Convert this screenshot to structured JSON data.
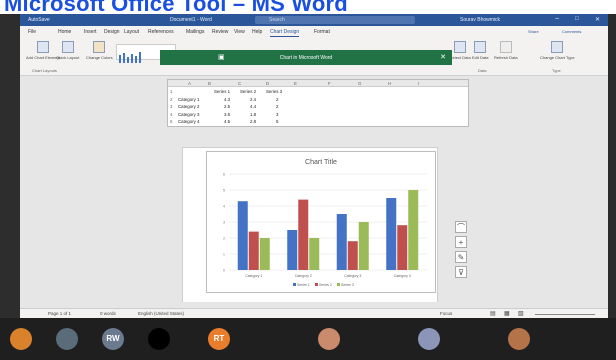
{
  "banner": {
    "text": "Microsoft Office Tool – MS Word"
  },
  "titlebar": {
    "autosave": "AutoSave",
    "doc": "Document1 - Word",
    "search": "Search",
    "user": "Sourav Bhowmick"
  },
  "tabs": [
    "File",
    "Home",
    "Insert",
    "Design",
    "Layout",
    "References",
    "Mailings",
    "Review",
    "View",
    "Help",
    "Chart Design",
    "Format"
  ],
  "share": "Share",
  "comments": "Comments",
  "ribbon": {
    "add_chart": "Add Chart Element",
    "quick_layout": "Quick Layout",
    "change_colors": "Change Colors",
    "group_layouts": "Chart Layouts",
    "select_data": "Select Data",
    "edit_data": "Edit Data",
    "refresh": "Refresh Data",
    "group_data": "Data",
    "change_type": "Change Chart Type",
    "group_type": "Type"
  },
  "chart_window": {
    "title": "Chart in Microsoft Word"
  },
  "sheet": {
    "cols": [
      "A",
      "B",
      "C",
      "D",
      "E",
      "F",
      "G",
      "H",
      "I"
    ],
    "headers": [
      "Series 1",
      "Series 2",
      "Series 3"
    ],
    "rows": [
      {
        "n": "1",
        "label": "",
        "v": [
          "Series 1",
          "Series 2",
          "Series 3"
        ]
      },
      {
        "n": "2",
        "label": "Category 1",
        "v": [
          "4.3",
          "2.4",
          "2"
        ]
      },
      {
        "n": "3",
        "label": "Category 2",
        "v": [
          "2.5",
          "4.4",
          "2"
        ]
      },
      {
        "n": "4",
        "label": "Category 3",
        "v": [
          "3.5",
          "1.8",
          "3"
        ]
      },
      {
        "n": "5",
        "label": "Category 4",
        "v": [
          "4.5",
          "2.8",
          "5"
        ]
      }
    ]
  },
  "status": {
    "page": "Page 1 of 1",
    "words": "0 words",
    "lang": "English (United States)",
    "focus": "Focus"
  },
  "participants": [
    {
      "initials": "",
      "color": "#d9822b"
    },
    {
      "initials": "",
      "color": "#5a6b7a"
    },
    {
      "initials": "RW",
      "color": "#6b7a8f"
    },
    {
      "initials": "",
      "color": "#000000"
    },
    {
      "initials": "RT",
      "color": "#e87d2b"
    },
    {
      "initials": "",
      "color": "#c98b6b"
    },
    {
      "initials": "",
      "color": "#8a95b8"
    },
    {
      "initials": "",
      "color": "#b5734a"
    }
  ],
  "chart_data": {
    "type": "bar",
    "title": "Chart Title",
    "categories": [
      "Category 1",
      "Category 2",
      "Category 3",
      "Category 4"
    ],
    "series": [
      {
        "name": "Series 1",
        "values": [
          4.3,
          2.5,
          3.5,
          4.5
        ],
        "color": "#4472c4"
      },
      {
        "name": "Series 2",
        "values": [
          2.4,
          4.4,
          1.8,
          2.8
        ],
        "color": "#c0504d"
      },
      {
        "name": "Series 3",
        "values": [
          2,
          2,
          3,
          5
        ],
        "color": "#9bbb59"
      }
    ],
    "ylim": [
      0,
      6
    ],
    "yticks": [
      "0",
      "1",
      "2",
      "3",
      "4",
      "5",
      "6"
    ],
    "legend": "bottom",
    "grid": true
  }
}
